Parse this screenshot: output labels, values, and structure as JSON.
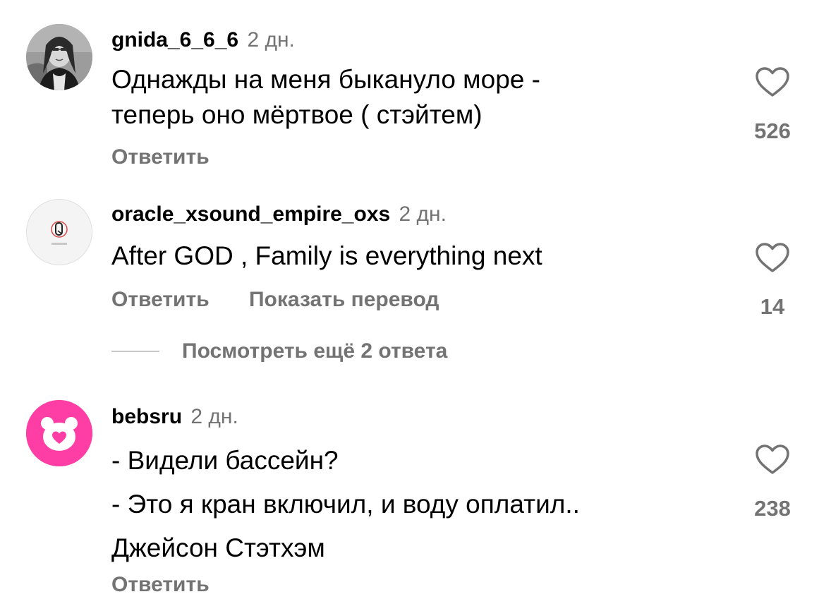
{
  "comments": [
    {
      "username": "gnida_6_6_6",
      "time": "2 дн.",
      "lines": [
        "Однажды на меня быкануло море -",
        "теперь оно мёртвое ( стэйтем)"
      ],
      "reply_label": "Ответить",
      "likes": "526",
      "avatar": "mona-lisa-avatar"
    },
    {
      "username": "oracle_xsound_empire_oxs",
      "time": "2 дн.",
      "lines": [
        "After GOD , Family is everything next"
      ],
      "reply_label": "Ответить",
      "translate_label": "Показать перевод",
      "likes": "14",
      "avatar": "oracle-logo-avatar",
      "view_replies": "Посмотреть ещё 2 ответа"
    },
    {
      "username": "bebsru",
      "time": "2 дн.",
      "lines": [
        "- Видели бассейн?",
        "- Это я кран включил, и воду оплатил..",
        "Джейсон Стэтхэм"
      ],
      "reply_label": "Ответить",
      "likes": "238",
      "avatar": "pink-bear-avatar"
    }
  ],
  "colors": {
    "secondary_text": "#737373",
    "primary_text": "#000000",
    "avatar_pink": "#ff3ea5"
  }
}
